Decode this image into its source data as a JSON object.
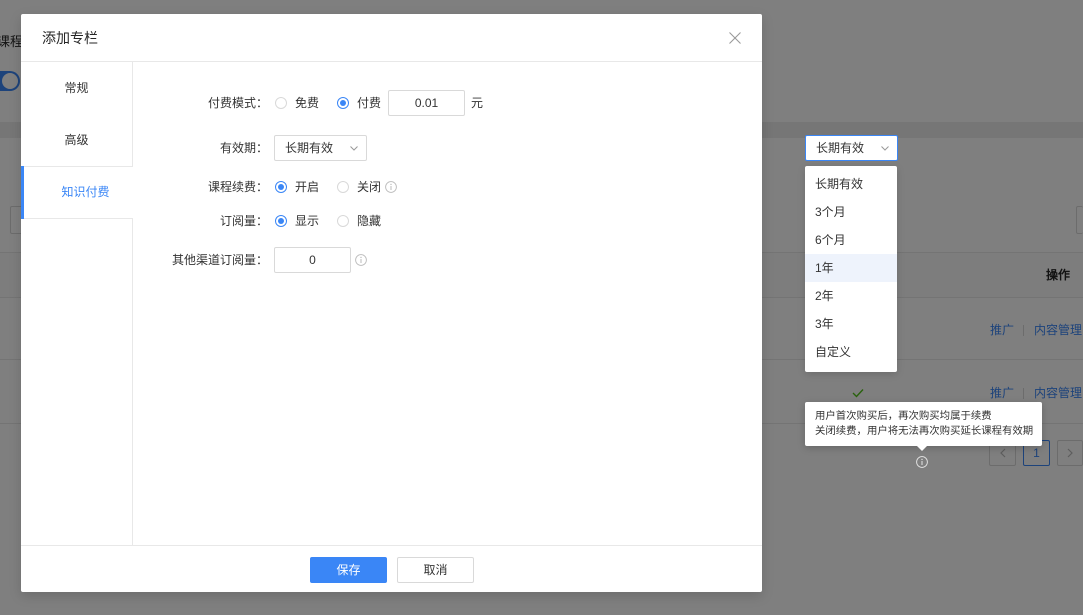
{
  "background_page": {
    "title_fragment": "课程.",
    "switch_on": true,
    "table_header": {
      "action": "操作"
    },
    "rows": [
      {
        "promote": "推广",
        "manage": "内容管理"
      },
      {
        "status_icon": "check-icon",
        "promote": "推广",
        "manage": "内容管理"
      }
    ],
    "pagination": {
      "prev_icon": "chevron-left-icon",
      "current_page": "1",
      "next_icon": "chevron-right-icon"
    }
  },
  "modal": {
    "title": "添加专栏",
    "close_icon": "close-icon",
    "tabs": [
      "常规",
      "高级",
      "知识付费"
    ],
    "active_tab_index": 2,
    "form": {
      "pay_mode": {
        "label": "付费模式：",
        "options": [
          "免费",
          "付费"
        ],
        "selected_index": 1,
        "price": "0.01",
        "unit": "元"
      },
      "validity": {
        "label": "有效期：",
        "value": "长期有效",
        "icon": "chevron-down-icon"
      },
      "renewal": {
        "label": "课程续费：",
        "options": [
          "开启",
          "关闭"
        ],
        "selected_index": 0,
        "info_icon": "info-icon"
      },
      "subscription_count": {
        "label": "订阅量：",
        "options": [
          "显示",
          "隐藏"
        ],
        "selected_index": 0
      },
      "other_channel_subscriptions": {
        "label": "其他渠道订阅量：",
        "value": "0",
        "info_icon": "info-icon"
      }
    },
    "footer": {
      "save_label": "保存",
      "cancel_label": "取消"
    }
  },
  "validity_dropdown": {
    "value": "长期有效",
    "icon": "chevron-down-icon",
    "options": [
      "长期有效",
      "3个月",
      "6个月",
      "1年",
      "2年",
      "3年",
      "自定义"
    ],
    "highlighted_index": 3
  },
  "renewal_tooltip": {
    "lines": [
      "用户首次购买后，再次购买均属于续费",
      "关闭续费，用户将无法再次购买延长课程有效期"
    ],
    "trigger_icon": "info-icon"
  },
  "colors": {
    "primary": "#3a86f6",
    "text": "#333333",
    "border": "#d9d9d9",
    "divider": "#e8e8e8",
    "hover": "#eef3fc",
    "success": "#52c41a"
  }
}
